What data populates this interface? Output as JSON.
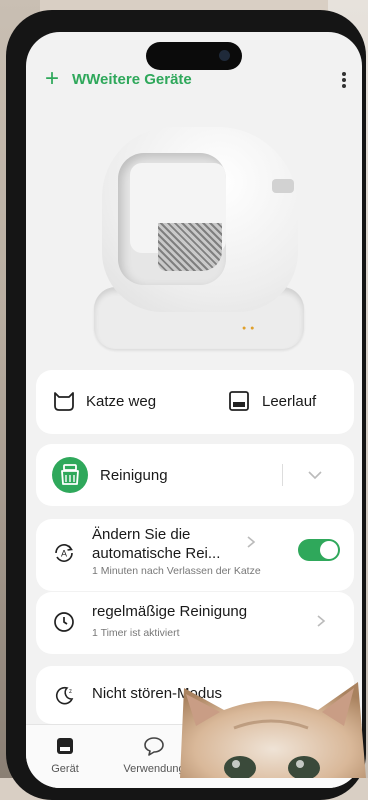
{
  "header": {
    "title": "WWeitere Geräte"
  },
  "status": {
    "cat": "Katze weg",
    "state": "Leerlauf"
  },
  "cleaning": {
    "label": "Reinigung"
  },
  "auto_clean": {
    "title": "Ändern Sie die automatische Rei...",
    "subtitle": "1 Minuten nach Verlassen der Katze",
    "enabled": true
  },
  "schedule": {
    "title": "regelmäßige Reinigung",
    "subtitle": "1 Timer ist aktiviert"
  },
  "dnd": {
    "title": "Nicht stören-Modus"
  },
  "tabs": [
    {
      "label": "Gerät"
    },
    {
      "label": "Verwendung"
    }
  ],
  "colors": {
    "accent": "#2fa85b",
    "card": "#ffffff",
    "screen_bg": "#f2f2f2"
  }
}
